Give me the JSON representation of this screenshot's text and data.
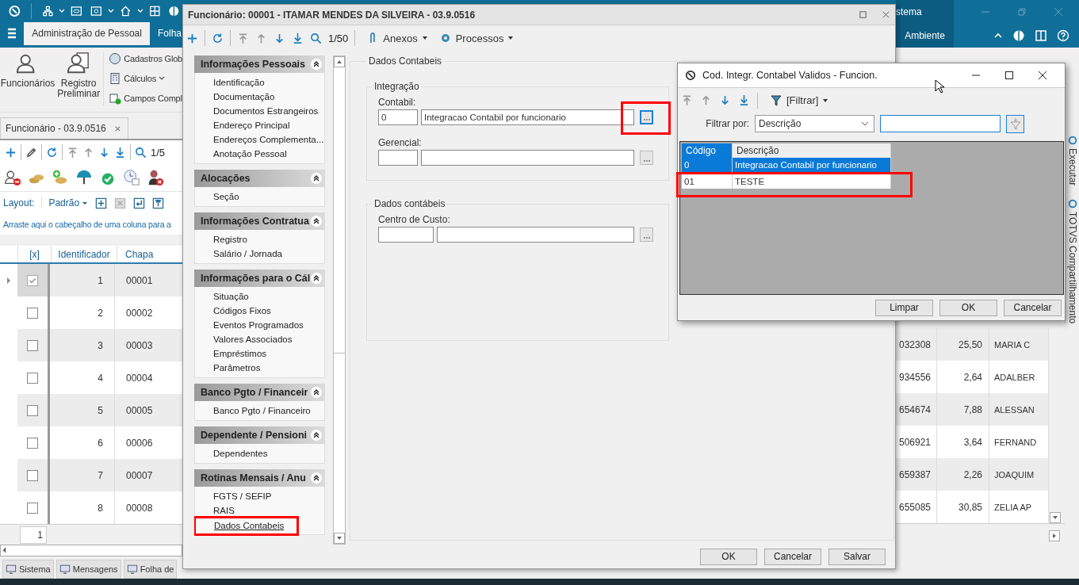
{
  "app": {
    "title_fragment": "stema",
    "ribbon_tabs": [
      {
        "label": "Administração de Pessoal",
        "selected": true
      },
      {
        "label": "Folha",
        "selected": false
      }
    ],
    "right_tab": {
      "label": "Ambiente"
    },
    "ribbon_large": [
      "Funcionários",
      "Registro Preliminar"
    ],
    "ribbon_small": [
      "Cadastros Glob",
      "Cálculos",
      "Campos Compl"
    ],
    "document_tab": "Funcionário - 03.9.0516",
    "record_counter": "1/5",
    "layout_label": "Layout:",
    "layout_value": "Padrão",
    "group_hint": "Arraste aqui o cabeçalho de uma coluna para a",
    "grid": {
      "columns": [
        "[x]",
        "Identificador",
        "Chapa"
      ],
      "rows": [
        {
          "selected": true,
          "checked": true,
          "id": "1",
          "chapa": "00001"
        },
        {
          "selected": false,
          "checked": false,
          "id": "2",
          "chapa": "00002"
        },
        {
          "selected": false,
          "checked": false,
          "id": "3",
          "chapa": "00003"
        },
        {
          "selected": false,
          "checked": false,
          "id": "4",
          "chapa": "00004"
        },
        {
          "selected": false,
          "checked": false,
          "id": "5",
          "chapa": "00005"
        },
        {
          "selected": false,
          "checked": false,
          "id": "6",
          "chapa": "00006"
        },
        {
          "selected": false,
          "checked": false,
          "id": "7",
          "chapa": "00007"
        },
        {
          "selected": false,
          "checked": false,
          "id": "8",
          "chapa": "00008"
        }
      ],
      "right_rows": [
        {
          "column_4": "032308",
          "column_5": "25,50",
          "column_6": "MARIA C"
        },
        {
          "column_4": "934556",
          "column_5": "2,64",
          "column_6": "ADALBER"
        },
        {
          "column_4": "654674",
          "column_5": "7,88",
          "column_6": "ALESSAN"
        },
        {
          "column_4": "506921",
          "column_5": "3,64",
          "column_6": "FERNAND"
        },
        {
          "column_4": "659387",
          "column_5": "2,26",
          "column_6": "JOAQUIM"
        },
        {
          "column_4": "655085",
          "column_5": "30,85",
          "column_6": "ZELIA AP"
        }
      ]
    },
    "page_field": "1",
    "status_tabs": [
      "Sistema",
      "Mensagens",
      "Folha de"
    ],
    "side_tabs": [
      "Executar",
      "TOTVS Compartilhamento"
    ]
  },
  "employee_window": {
    "title": "Funcionário: 00001 - ITAMAR MENDES DA SILVEIRA - 03.9.0516",
    "counter": "1/50",
    "menus": [
      "Anexos",
      "Processos"
    ],
    "sections": [
      {
        "title": "Informações Pessoais",
        "expanded": true,
        "items": [
          {
            "label": "Identificação",
            "selected": false,
            "highlighted": false
          },
          {
            "label": "Documentação",
            "selected": false,
            "highlighted": false
          },
          {
            "label": "Documentos Estrangeiros",
            "selected": false,
            "highlighted": false
          },
          {
            "label": "Endereço Principal",
            "selected": false,
            "highlighted": false
          },
          {
            "label": "Endereços Complementa...",
            "selected": false,
            "highlighted": false
          },
          {
            "label": "Anotação Pessoal",
            "selected": false,
            "highlighted": false
          }
        ]
      },
      {
        "title": "Alocações",
        "expanded": true,
        "items": [
          {
            "label": "Seção",
            "selected": false,
            "highlighted": false
          }
        ]
      },
      {
        "title": "Informações Contratua",
        "expanded": true,
        "items": [
          {
            "label": "Registro",
            "selected": false,
            "highlighted": false
          },
          {
            "label": "Salário / Jornada",
            "selected": false,
            "highlighted": false
          }
        ]
      },
      {
        "title": "Informações para o Cál",
        "expanded": true,
        "items": [
          {
            "label": "Situação",
            "selected": false,
            "highlighted": false
          },
          {
            "label": "Códigos Fixos",
            "selected": false,
            "highlighted": false
          },
          {
            "label": "Eventos Programados",
            "selected": false,
            "highlighted": false
          },
          {
            "label": "Valores Associados",
            "selected": false,
            "highlighted": false
          },
          {
            "label": "Empréstimos",
            "selected": false,
            "highlighted": false
          },
          {
            "label": "Parâmetros",
            "selected": false,
            "highlighted": false
          }
        ]
      },
      {
        "title": "Banco Pgto / Financeir",
        "expanded": true,
        "items": [
          {
            "label": "Banco Pgto / Financeiro",
            "selected": false,
            "highlighted": false
          }
        ]
      },
      {
        "title": "Dependente / Pensioni",
        "expanded": true,
        "items": [
          {
            "label": "Dependentes",
            "selected": false,
            "highlighted": false
          }
        ]
      },
      {
        "title": "Rotinas Mensais / Anu",
        "expanded": true,
        "items": [
          {
            "label": "FGTS / SEFIP",
            "selected": false,
            "highlighted": false
          },
          {
            "label": "RAIS",
            "selected": false,
            "highlighted": false
          },
          {
            "label": "Dados Contabeis",
            "selected": true,
            "highlighted": true
          }
        ]
      }
    ],
    "panel_title": "Dados Contabeis",
    "groups": [
      {
        "title": "Integração",
        "fields": [
          {
            "label": "Contabil:",
            "code": "0",
            "description": "Integracao Contabil por funcionario",
            "focused": true,
            "highlighted": true,
            "wide": false
          },
          {
            "label": "Gerencial:",
            "focused": false,
            "highlighted": false,
            "wide": false
          }
        ]
      },
      {
        "title": "Dados contábeis",
        "fields": [
          {
            "label": "Centro de Custo:",
            "focused": false,
            "highlighted": false,
            "wide": true
          }
        ]
      }
    ],
    "buttons": [
      "OK",
      "Cancelar",
      "Salvar"
    ]
  },
  "lookup_window": {
    "title": "Cod. Integr. Contabel Validos - Funcion.",
    "filter_menu": "[Filtrar]",
    "filter_label": "Filtrar por:",
    "filter_field": "Descrição",
    "columns": [
      "Código",
      "Descrição"
    ],
    "rows": [
      {
        "code": "0",
        "description": "Integracao Contabil por funcionario",
        "selected": true,
        "highlighted": false
      },
      {
        "code": "01",
        "description": "TESTE",
        "selected": false,
        "highlighted": true
      }
    ],
    "buttons": [
      "Limpar",
      "OK",
      "Cancelar"
    ]
  }
}
